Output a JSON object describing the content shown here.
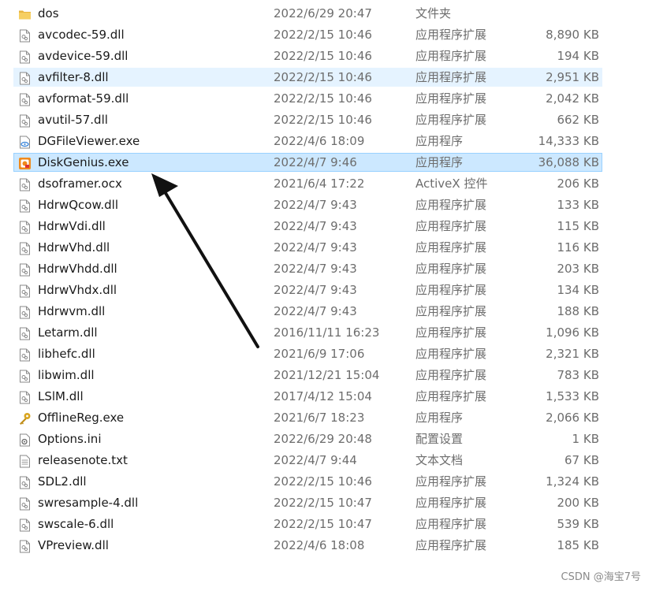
{
  "files": [
    {
      "name": "dos",
      "date": "2022/6/29 20:47",
      "type": "文件夹",
      "size": "",
      "icon": "folder-icon"
    },
    {
      "name": "avcodec-59.dll",
      "date": "2022/2/15 10:46",
      "type": "应用程序扩展",
      "size": "8,890 KB",
      "icon": "dll-file-icon"
    },
    {
      "name": "avdevice-59.dll",
      "date": "2022/2/15 10:46",
      "type": "应用程序扩展",
      "size": "194 KB",
      "icon": "dll-file-icon"
    },
    {
      "name": "avfilter-8.dll",
      "date": "2022/2/15 10:46",
      "type": "应用程序扩展",
      "size": "2,951 KB",
      "icon": "dll-file-icon",
      "state": "hover"
    },
    {
      "name": "avformat-59.dll",
      "date": "2022/2/15 10:46",
      "type": "应用程序扩展",
      "size": "2,042 KB",
      "icon": "dll-file-icon"
    },
    {
      "name": "avutil-57.dll",
      "date": "2022/2/15 10:46",
      "type": "应用程序扩展",
      "size": "662 KB",
      "icon": "dll-file-icon"
    },
    {
      "name": "DGFileViewer.exe",
      "date": "2022/4/6 18:09",
      "type": "应用程序",
      "size": "14,333 KB",
      "icon": "file-viewer-app-icon"
    },
    {
      "name": "DiskGenius.exe",
      "date": "2022/4/7 9:46",
      "type": "应用程序",
      "size": "36,088 KB",
      "icon": "diskgenius-app-icon",
      "state": "selected"
    },
    {
      "name": "dsoframer.ocx",
      "date": "2021/6/4 17:22",
      "type": "ActiveX 控件",
      "size": "206 KB",
      "icon": "ocx-file-icon"
    },
    {
      "name": "HdrwQcow.dll",
      "date": "2022/4/7 9:43",
      "type": "应用程序扩展",
      "size": "133 KB",
      "icon": "dll-file-icon"
    },
    {
      "name": "HdrwVdi.dll",
      "date": "2022/4/7 9:43",
      "type": "应用程序扩展",
      "size": "115 KB",
      "icon": "dll-file-icon"
    },
    {
      "name": "HdrwVhd.dll",
      "date": "2022/4/7 9:43",
      "type": "应用程序扩展",
      "size": "116 KB",
      "icon": "dll-file-icon"
    },
    {
      "name": "HdrwVhdd.dll",
      "date": "2022/4/7 9:43",
      "type": "应用程序扩展",
      "size": "203 KB",
      "icon": "dll-file-icon"
    },
    {
      "name": "HdrwVhdx.dll",
      "date": "2022/4/7 9:43",
      "type": "应用程序扩展",
      "size": "134 KB",
      "icon": "dll-file-icon"
    },
    {
      "name": "Hdrwvm.dll",
      "date": "2022/4/7 9:43",
      "type": "应用程序扩展",
      "size": "188 KB",
      "icon": "dll-file-icon"
    },
    {
      "name": "Letarm.dll",
      "date": "2016/11/11 16:23",
      "type": "应用程序扩展",
      "size": "1,096 KB",
      "icon": "dll-file-icon"
    },
    {
      "name": "libhefc.dll",
      "date": "2021/6/9 17:06",
      "type": "应用程序扩展",
      "size": "2,321 KB",
      "icon": "dll-file-icon"
    },
    {
      "name": "libwim.dll",
      "date": "2021/12/21 15:04",
      "type": "应用程序扩展",
      "size": "783 KB",
      "icon": "dll-file-icon"
    },
    {
      "name": "LSlM.dll",
      "date": "2017/4/12 15:04",
      "type": "应用程序扩展",
      "size": "1,533 KB",
      "icon": "dll-file-icon"
    },
    {
      "name": "OfflineReg.exe",
      "date": "2021/6/7 18:23",
      "type": "应用程序",
      "size": "2,066 KB",
      "icon": "key-app-icon"
    },
    {
      "name": "Options.ini",
      "date": "2022/6/29 20:48",
      "type": "配置设置",
      "size": "1 KB",
      "icon": "ini-file-icon"
    },
    {
      "name": "releasenote.txt",
      "date": "2022/4/7 9:44",
      "type": "文本文档",
      "size": "67 KB",
      "icon": "text-file-icon"
    },
    {
      "name": "SDL2.dll",
      "date": "2022/2/15 10:46",
      "type": "应用程序扩展",
      "size": "1,324 KB",
      "icon": "dll-file-icon"
    },
    {
      "name": "swresample-4.dll",
      "date": "2022/2/15 10:47",
      "type": "应用程序扩展",
      "size": "200 KB",
      "icon": "dll-file-icon"
    },
    {
      "name": "swscale-6.dll",
      "date": "2022/2/15 10:47",
      "type": "应用程序扩展",
      "size": "539 KB",
      "icon": "dll-file-icon"
    },
    {
      "name": "VPreview.dll",
      "date": "2022/4/6 18:08",
      "type": "应用程序扩展",
      "size": "185 KB",
      "icon": "dll-file-icon"
    }
  ],
  "watermark": "CSDN @海宝7号",
  "colors": {
    "hover_bg": "#e5f3ff",
    "selected_bg": "#cce8ff",
    "selected_border": "#99d1ff",
    "folder": "#f4c95d",
    "arrow": "#111111"
  }
}
